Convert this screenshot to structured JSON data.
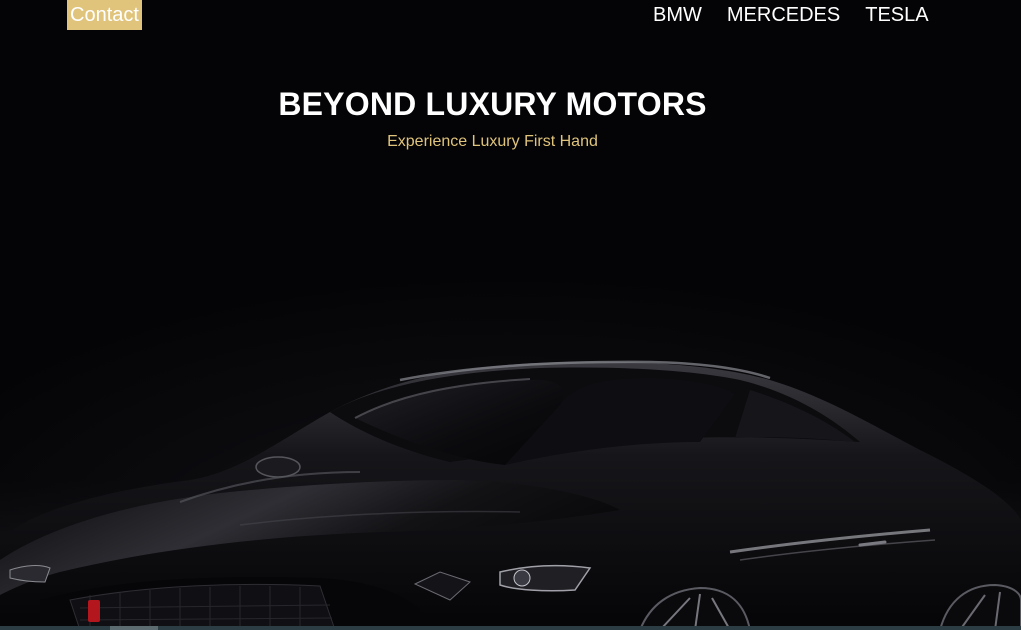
{
  "header": {
    "contact_label": "Contact",
    "nav": [
      {
        "label": "BMW"
      },
      {
        "label": "MERCEDES"
      },
      {
        "label": "TESLA"
      }
    ]
  },
  "hero": {
    "title": "BEYOND LUXURY MOTORS",
    "tagline": "Experience Luxury First Hand",
    "image_icon": "black-sports-car-photo"
  },
  "colors": {
    "accent": "#e0c47c",
    "background": "#040406",
    "text": "#ffffff"
  }
}
